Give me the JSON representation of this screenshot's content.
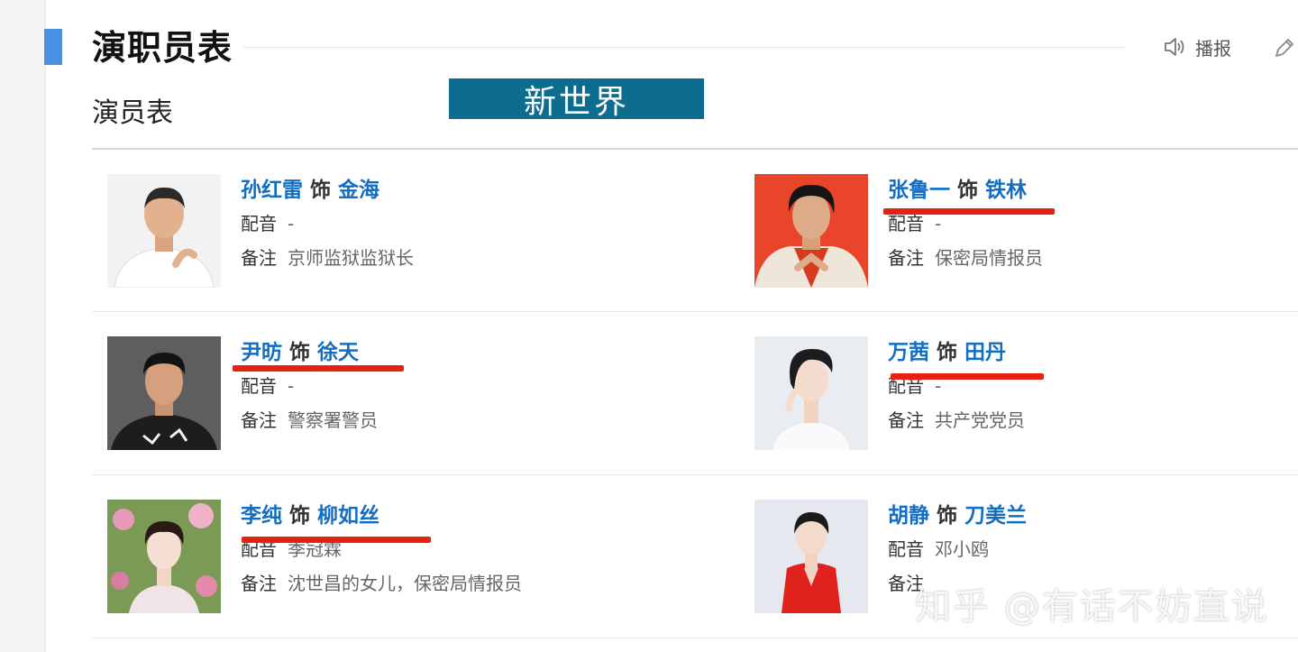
{
  "header": {
    "title": "演职员表",
    "play_label": "播报",
    "subtitle": "演员表",
    "banner_text": "新世界"
  },
  "cast": [
    {
      "actor": "孙红雷",
      "act_word": "饰",
      "role": "金海",
      "voice_label": "配音",
      "voice_value": "-",
      "note_label": "备注",
      "note_value": "京师监狱监狱长"
    },
    {
      "actor": "张鲁一",
      "act_word": "饰",
      "role": "铁林",
      "voice_label": "配音",
      "voice_value": "-",
      "note_label": "备注",
      "note_value": "保密局情报员"
    },
    {
      "actor": "尹昉",
      "act_word": "饰",
      "role": "徐天",
      "voice_label": "配音",
      "voice_value": "-",
      "note_label": "备注",
      "note_value": "警察署警员"
    },
    {
      "actor": "万茜",
      "act_word": "饰",
      "role": "田丹",
      "voice_label": "配音",
      "voice_value": "-",
      "note_label": "备注",
      "note_value": "共产党党员"
    },
    {
      "actor": "李纯",
      "act_word": "饰",
      "role": "柳如丝",
      "voice_label": "配音",
      "voice_value": "季冠霖",
      "note_label": "备注",
      "note_value": "沈世昌的女儿，保密局情报员"
    },
    {
      "actor": "胡静",
      "act_word": "饰",
      "role": "刀美兰",
      "voice_label": "配音",
      "voice_value": "邓小鸥",
      "note_label": "备注",
      "note_value": ""
    }
  ],
  "watermark": "知乎 @有话不妨直说",
  "colors": {
    "link_blue": "#136ec2",
    "accent_blue": "#4a90e2",
    "banner_teal": "#0c6d8f",
    "annotation_red": "#e4220f"
  },
  "icons": [
    "speaker-icon",
    "pencil-icon"
  ]
}
